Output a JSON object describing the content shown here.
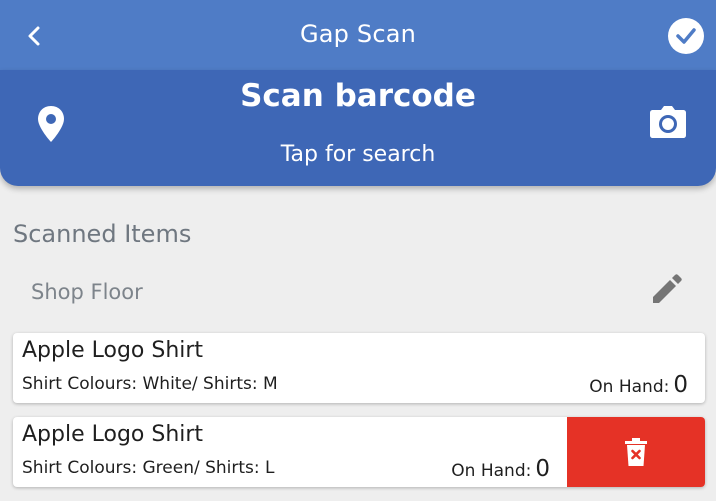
{
  "header": {
    "title": "Gap Scan",
    "back_icon": "chevron-left-icon",
    "confirm_icon": "check-circle-icon"
  },
  "scan": {
    "title": "Scan barcode",
    "subtitle": "Tap for search",
    "location_icon": "map-pin-icon",
    "camera_icon": "camera-icon"
  },
  "section": {
    "heading": "Scanned Items"
  },
  "location": {
    "name": "Shop Floor",
    "edit_icon": "pencil-icon"
  },
  "items": [
    {
      "name": "Apple Logo Shirt",
      "variant": "Shirt Colours: White/ Shirts: M",
      "on_hand_label": "On Hand:",
      "on_hand_value": "0"
    },
    {
      "name": "Apple Logo Shirt",
      "variant": "Shirt Colours: Green/ Shirts: L",
      "on_hand_label": "On Hand:",
      "on_hand_value": "0",
      "delete_icon": "trash-icon"
    }
  ],
  "colors": {
    "topbar": "#4f7cc6",
    "scanbar": "#3e67b6",
    "background": "#eeeeee",
    "delete": "#e53226"
  }
}
